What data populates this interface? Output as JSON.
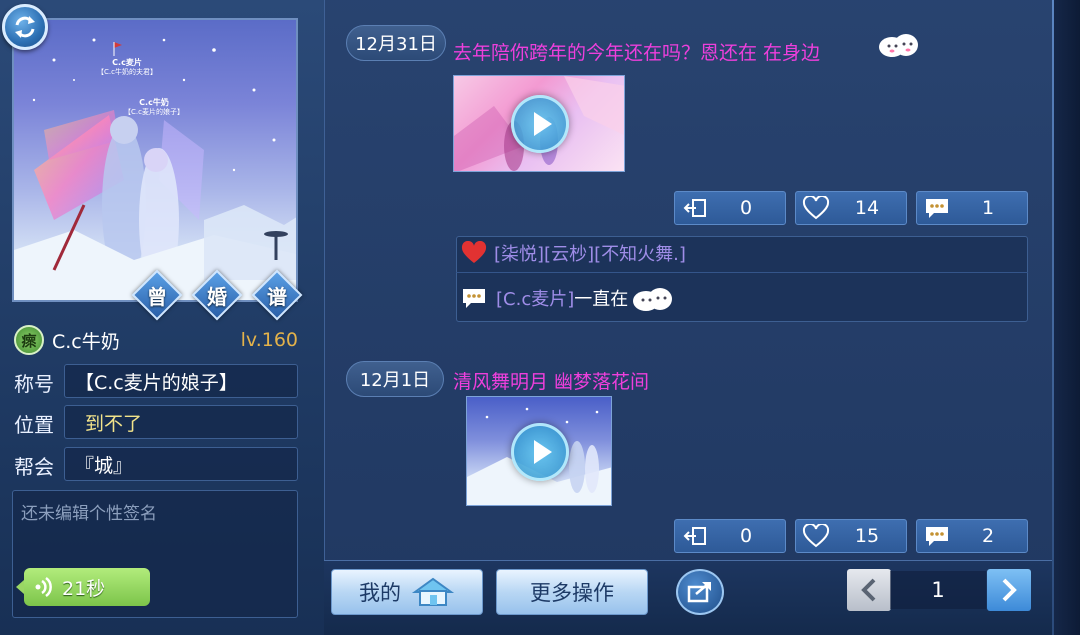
{
  "profile": {
    "name": "C.c牛奶",
    "level": "lv.160",
    "badge_char": "瘝",
    "portrait_tags": {
      "tag1_name": "C.c麦片",
      "tag1_sub": "【C.c牛奶的夫君】",
      "tag2_name": "C.c牛奶",
      "tag2_sub": "【C.c麦片的娘子】"
    },
    "hex_buttons": [
      "曾",
      "婚",
      "谱"
    ],
    "fields": [
      {
        "label": "称号",
        "value": "【C.c麦片的娘子】",
        "color": "#ffffff"
      },
      {
        "label": "位置",
        "value": "到不了",
        "color": "#f2e38a"
      },
      {
        "label": "帮会",
        "value": "『城』",
        "color": "#ffffff"
      }
    ],
    "signature_placeholder": "还未编辑个性签名",
    "voice_duration": "21秒"
  },
  "feed": {
    "posts": [
      {
        "date": "12月31日",
        "text": "去年陪你跨年的今年还在吗？恩还在 在身边",
        "stats": {
          "shares": "0",
          "likes": "14",
          "comments": "1"
        },
        "likers": "[柒悦][云杪][不知火舞.]",
        "comment_author": "[C.c麦片]",
        "comment_text": "一直在"
      },
      {
        "date": "12月1日",
        "text": "清风舞明月 幽梦落花间",
        "stats": {
          "shares": "0",
          "likes": "15",
          "comments": "2"
        }
      }
    ]
  },
  "bottom": {
    "my_button": "我的",
    "more_button": "更多操作",
    "page": "1"
  },
  "colors": {
    "post_text": "#ee3fdc",
    "level": "#e3b24a",
    "liker_names": "#9f8de8",
    "accent_blue": "#3e6eb0"
  }
}
